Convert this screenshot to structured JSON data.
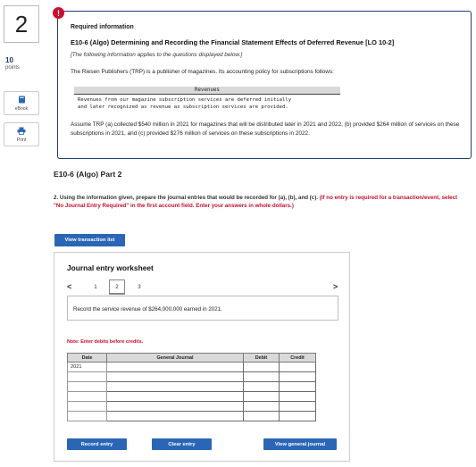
{
  "rail": {
    "question_number": "2",
    "points_value": "10",
    "points_label": "points",
    "ebook_label": "eBook",
    "print_label": "Print"
  },
  "required": {
    "badge": "!",
    "title": "Required information",
    "heading": "E10-6 (Algo) Determining and Recording the Financial Statement Effects of Deferred Revenue [LO 10-2]",
    "italic_note": "[The following information applies to the questions displayed below.]",
    "intro": "The Riesen Publishers (TRP) is a publisher of magazines. Its accounting policy for subscriptions follows:",
    "policy_header": "Revenues",
    "policy_body": "Revenues from our magazine subscription services are deferred initially\nand later recognized as revenue as subscription services are provided.",
    "assumption": "Assume TRP (a) collected $540 million in 2021 for magazines that will be distributed later in 2021 and 2022, (b) provided $264 million of services on these subscriptions in 2021, and (c) provided $276 million of services on these subscriptions in 2022."
  },
  "part": {
    "title": "E10-6 (Algo) Part 2",
    "instruction_main": "2. Using the information given, prepare the journal entries that would be recorded for (a), (b), and (c). ",
    "instruction_red": "(If no entry is required for a transaction/event, select \"No Journal Entry Required\" in the first account field. Enter your answers in whole dollars.)",
    "view_transaction_list": "View transaction list"
  },
  "worksheet": {
    "title": "Journal entry worksheet",
    "prev_glyph": "<",
    "next_glyph": ">",
    "pages": [
      "1",
      "2",
      "3"
    ],
    "active_page": "2",
    "prompt": "Record the service revenue of $264,000,000 earned in 2021.",
    "note": "Note: Enter debits before credits.",
    "columns": {
      "date": "Date",
      "general_journal": "General Journal",
      "debit": "Debit",
      "credit": "Credit"
    },
    "rows": [
      {
        "date": "2021",
        "account": "",
        "debit": "",
        "credit": ""
      },
      {
        "date": "",
        "account": "",
        "debit": "",
        "credit": ""
      },
      {
        "date": "",
        "account": "",
        "debit": "",
        "credit": ""
      },
      {
        "date": "",
        "account": "",
        "debit": "",
        "credit": ""
      },
      {
        "date": "",
        "account": "",
        "debit": "",
        "credit": ""
      },
      {
        "date": "",
        "account": "",
        "debit": "",
        "credit": ""
      }
    ],
    "record_entry": "Record entry",
    "clear_entry": "Clear entry",
    "view_general_journal": "View general journal"
  }
}
